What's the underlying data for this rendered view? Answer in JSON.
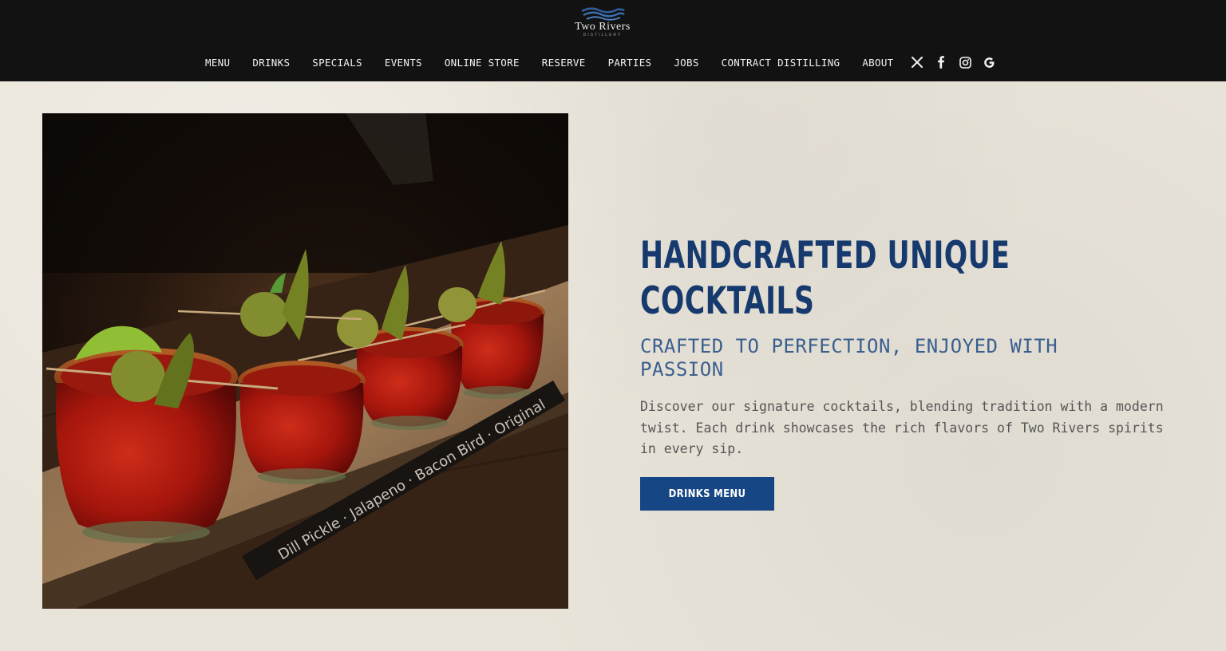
{
  "header": {
    "logo": {
      "name": "Two Rivers",
      "subtitle": "DISTILLERY"
    },
    "nav": [
      {
        "label": "MENU"
      },
      {
        "label": "DRINKS"
      },
      {
        "label": "SPECIALS"
      },
      {
        "label": "EVENTS"
      },
      {
        "label": "ONLINE STORE"
      },
      {
        "label": "RESERVE"
      },
      {
        "label": "PARTIES"
      },
      {
        "label": "JOBS"
      },
      {
        "label": "CONTRACT DISTILLING"
      },
      {
        "label": "ABOUT"
      }
    ],
    "social_icons": [
      "x-icon",
      "facebook-icon",
      "instagram-icon",
      "google-icon"
    ]
  },
  "hero": {
    "image_subject": "caesar cocktails on wooden board",
    "board_text": [
      "Dill Pickle",
      "Jalapeno",
      "Bacon Bird",
      "Original"
    ],
    "headline": "HANDCRAFTED UNIQUE COCKTAILS",
    "subheadline": "CRAFTED TO PERFECTION, ENJOYED WITH PASSION",
    "body": "Discover our signature cocktails, blending tradition with a modern twist. Each drink showcases the rich flavors of Two Rivers spirits in every sip.",
    "cta_label": "DRINKS MENU"
  },
  "colors": {
    "header_bg": "#121212",
    "page_bg": "#e9e4d9",
    "brand_blue": "#173a6e",
    "button_blue": "#164683",
    "sub_blue": "#3a5f8f",
    "body_text": "#555555"
  }
}
